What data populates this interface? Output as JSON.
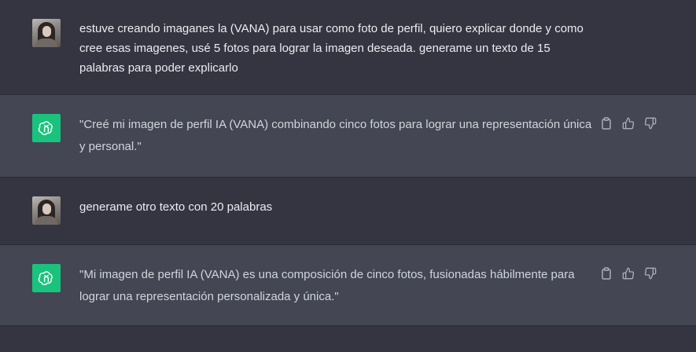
{
  "messages": [
    {
      "role": "user",
      "avatar": "user-avatar-photo",
      "text": "estuve creando imaganes la (VANA) para usar como foto de perfil, quiero explicar donde y como cree esas imagenes, usé 5 fotos para lograr la imagen deseada. generame un texto de 15 palabras para poder explicarlo"
    },
    {
      "role": "assistant",
      "avatar": "openai-logo-icon",
      "text": "\"Creé mi imagen de perfil IA (VANA) combinando cinco fotos para lograr una representación única y personal.\"",
      "actions": [
        "copy-icon",
        "thumbs-up-icon",
        "thumbs-down-icon"
      ]
    },
    {
      "role": "user",
      "avatar": "user-avatar-photo",
      "text": "generame otro texto con 20 palabras"
    },
    {
      "role": "assistant",
      "avatar": "openai-logo-icon",
      "text": "\"Mi imagen de perfil IA (VANA) es una composición de cinco fotos, fusionadas hábilmente para lograr una representación personalizada y única.\"",
      "actions": [
        "copy-icon",
        "thumbs-up-icon",
        "thumbs-down-icon"
      ]
    }
  ],
  "colors": {
    "user_bg": "#343541",
    "assistant_bg": "#444654",
    "gpt_avatar": "#19c37d",
    "text": "#ececf1",
    "icon": "#acacbe"
  }
}
